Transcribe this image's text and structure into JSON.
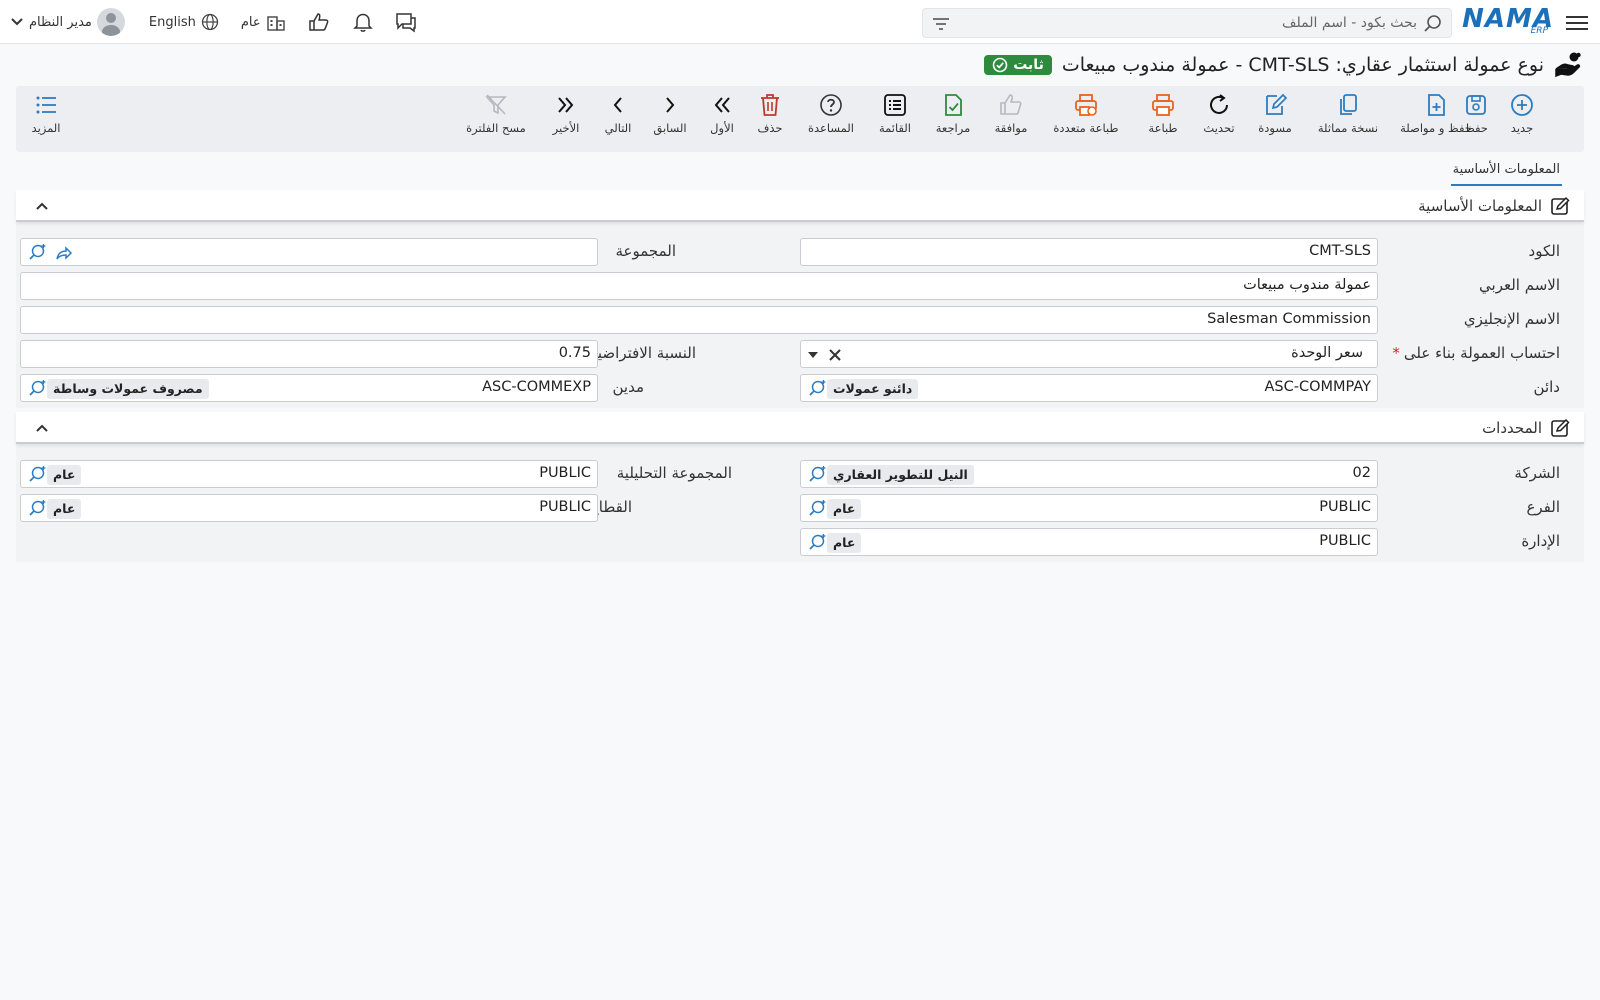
{
  "topbar": {
    "logo_text": "NAMA",
    "logo_sub": "ERP",
    "search_placeholder": "بحث بكود - اسم الملف",
    "user_name": "مدير النظام",
    "language": "English",
    "branch": "عام"
  },
  "title": {
    "text": "نوع عمولة استثمار عقاري: CMT-SLS - عمولة مندوب مبيعات",
    "status": "ثابت"
  },
  "toolbar": {
    "new": "جديد",
    "save": "حفظ",
    "save_continue": "حفظ و مواصلة",
    "duplicate": "نسخة مماثلة",
    "draft": "مسودة",
    "refresh": "تحديث",
    "print": "طباعة",
    "multi_print": "طباعة متعددة",
    "approve": "موافقة",
    "review": "مراجعة",
    "list": "القائمة",
    "help": "المساعدة",
    "delete": "حذف",
    "first": "الأول",
    "previous": "السابق",
    "next": "التالي",
    "last": "الأخير",
    "clear_filter": "مسح الفلترة",
    "more": "المزيد"
  },
  "tabs": {
    "basic_info": "المعلومات الأساسية"
  },
  "basic_section": {
    "title": "المعلومات الأساسية",
    "code_label": "الكود",
    "code_value": "CMT-SLS",
    "group_label": "المجموعة",
    "group_value": "",
    "arabic_name_label": "الاسم العربي",
    "arabic_name_value": "عمولة مندوب مبيعات",
    "english_name_label": "الاسم الإنجليزي",
    "english_name_value": "Salesman Commission",
    "calc_basis_label": "احتساب العمولة بناء على",
    "calc_basis_required": "*",
    "calc_basis_value": "سعر الوحدة",
    "default_rate_label": "النسبة الافتراضية",
    "default_rate_value": "0.75",
    "creditor_label": "دائن",
    "creditor_code": "ASC-COMMPAY",
    "creditor_name": "دائنو عمولات",
    "debtor_label": "مدين",
    "debtor_code": "ASC-COMMEXP",
    "debtor_name": "مصروف عمولات وساطة"
  },
  "limits_section": {
    "title": "المحددات",
    "company_label": "الشركة",
    "company_code": "02",
    "company_name": "النيل للتطوير العقاري",
    "analytic_group_label": "المجموعة التحليلية",
    "analytic_group_code": "PUBLIC",
    "analytic_group_name": "عام",
    "branch_label": "الفرع",
    "branch_code": "PUBLIC",
    "branch_name": "عام",
    "sector_label": "القطاع",
    "sector_code": "PUBLIC",
    "sector_name": "عام",
    "department_label": "الإدارة",
    "department_code": "PUBLIC",
    "department_name": "عام"
  },
  "colors": {
    "accent": "#2d7cc1",
    "orange": "#e8641e",
    "red": "#c0392b",
    "green": "#2e8b3e",
    "status_bg": "#2e8b3e"
  }
}
